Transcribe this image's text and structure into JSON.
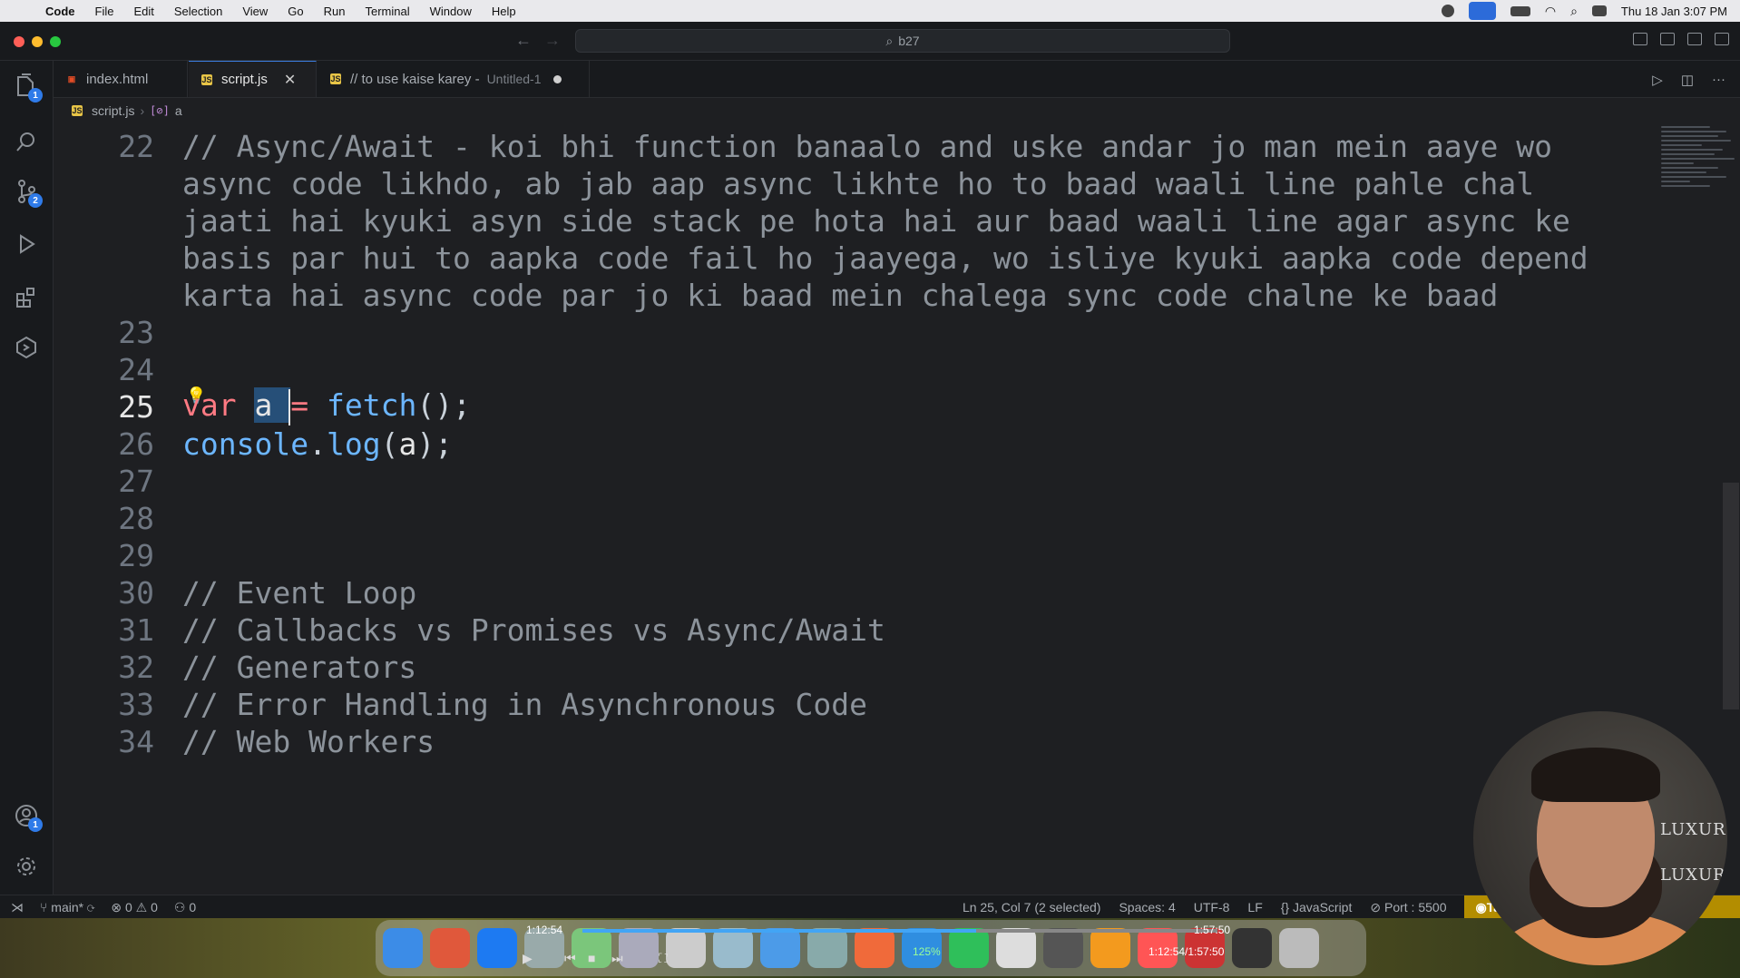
{
  "menubar": {
    "app": "Code",
    "items": [
      "File",
      "Edit",
      "Selection",
      "View",
      "Go",
      "Run",
      "Terminal",
      "Window",
      "Help"
    ],
    "datetime": "Thu 18 Jan  3:07 PM"
  },
  "titlebar": {
    "search": "b27"
  },
  "activity": {
    "explorer_badge": "1",
    "scm_badge": "2",
    "accounts_badge": "1"
  },
  "tabs": [
    {
      "icon": "html",
      "label": "index.html"
    },
    {
      "icon": "js",
      "label": "script.js"
    },
    {
      "icon": "js",
      "label": "// to use kaise karey -",
      "sub": "Untitled-1"
    }
  ],
  "breadcrumb": {
    "file": "script.js",
    "symbol_icon": "[⊘]",
    "symbol": "a"
  },
  "editor": {
    "lines": [
      {
        "num": "22",
        "text": "// Async/Await - koi bhi function banaalo and uske andar jo man mein aaye wo"
      },
      {
        "num": "",
        "text": "async code likhdo, ab jab aap async likhte ho to baad waali line pahle chal"
      },
      {
        "num": "",
        "text": "jaati hai kyuki asyn side stack pe hota hai aur baad waali line agar async ke"
      },
      {
        "num": "",
        "text": "basis par hui to aapka code fail ho jaayega, wo isliye kyuki aapka code depend"
      },
      {
        "num": "",
        "text": "karta hai async code par jo ki baad mein chalega sync code chalne ke baad"
      },
      {
        "num": "23",
        "text": ""
      },
      {
        "num": "24",
        "text": ""
      },
      {
        "num": "25",
        "text": "var a = fetch();"
      },
      {
        "num": "26",
        "text": "console.log(a);"
      },
      {
        "num": "27",
        "text": ""
      },
      {
        "num": "28",
        "text": ""
      },
      {
        "num": "29",
        "text": ""
      },
      {
        "num": "30",
        "text": "// Event Loop"
      },
      {
        "num": "31",
        "text": "// Callbacks vs Promises vs Async/Await"
      },
      {
        "num": "32",
        "text": "// Generators"
      },
      {
        "num": "33",
        "text": "// Error Handling in Asynchronous Code"
      },
      {
        "num": "34",
        "text": "// Web Workers"
      }
    ]
  },
  "statusbar": {
    "branch": "main*",
    "problems": "⊗ 0 ⚠ 0",
    "ports": "⚇ 0",
    "position": "Ln 25, Col 7 (2 selected)",
    "spaces": "Spaces: 4",
    "encoding": "UTF-8",
    "eol": "LF",
    "language": "JavaScript",
    "port": "Port : 5500",
    "tabnine": "Tabnine:"
  },
  "player": {
    "elapsed": "1:12:54",
    "total": "1:57:50",
    "combined": "1:12:54/1:57:50",
    "volume": "125%",
    "progress": 0.62
  },
  "webcam": {
    "logo": "LUXUR"
  },
  "colors": {
    "accent": "#3b7de0",
    "keyword": "#ff7a83",
    "function": "#6cb6ff",
    "comment": "#8c939b",
    "selection": "#264f78",
    "tabnine": "#b38d00"
  }
}
